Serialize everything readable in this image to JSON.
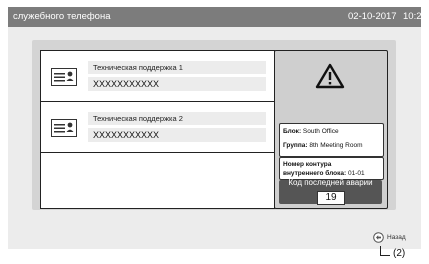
{
  "header": {
    "title": "служебного телефона",
    "date": "02-10-2017",
    "time": "10:20"
  },
  "contacts": [
    {
      "name": "Техническая поддержка 1",
      "phone": "XXXXXXXXXXX",
      "icon": "contact-card-icon"
    },
    {
      "name": "Техническая поддержка 2",
      "phone": "XXXXXXXXXXX",
      "icon": "contact-card-icon"
    }
  ],
  "alarm": {
    "icon": "warning-triangle-icon",
    "block_label": "Блок:",
    "block_value": "South Office",
    "group_label": "Группа:",
    "group_value": "8th Meeting Room",
    "unit_label_line1": "Номер контура",
    "unit_label_line2": "внутреннего блока:",
    "unit_value": "01-01",
    "code_label": "Код последней аварии",
    "code_value": "19"
  },
  "footer": {
    "back_label": "Назад",
    "back_icon": "back-arrow-icon"
  },
  "callout": {
    "label": "(2)"
  }
}
